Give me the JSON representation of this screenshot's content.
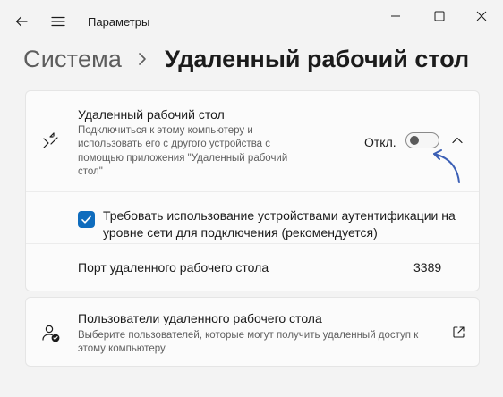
{
  "window": {
    "title": "Параметры"
  },
  "breadcrumb": {
    "parent": "Система",
    "current": "Удаленный рабочий стол"
  },
  "remote_desktop": {
    "title": "Удаленный рабочий стол",
    "description": "Подключиться к этому компьютеру и использовать его с другого устройства с помощью приложения \"Удаленный рабочий стол\"",
    "toggle_label": "Откл.",
    "toggle_on": false,
    "icon": "remote-desktop-icon"
  },
  "nla": {
    "label": "Требовать использование устройствами аутентификации на уровне сети для подключения (рекомендуется)",
    "checked": true
  },
  "port": {
    "label": "Порт удаленного рабочего стола",
    "value": "3389"
  },
  "remote_users": {
    "title": "Пользователи удаленного рабочего стола",
    "description": "Выберите пользователей, которые могут получить удаленный доступ к этому компьютеру",
    "icon": "users-icon",
    "action_icon": "open-external-icon"
  },
  "colors": {
    "accent": "#0f6cbd",
    "annotation_arrow": "#3b5fb5",
    "background": "#f3f3f3",
    "card": "#fbfbfb"
  }
}
